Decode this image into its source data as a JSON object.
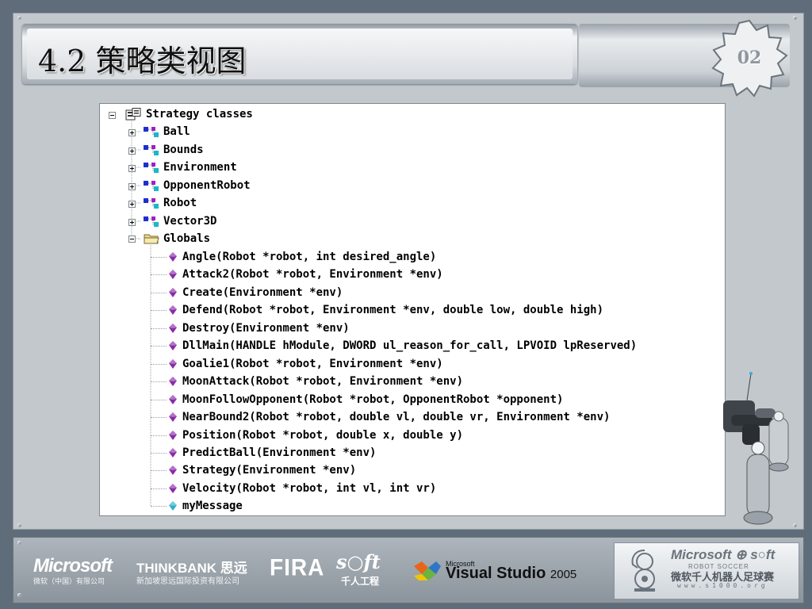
{
  "slide": {
    "title": "4.2 策略类视图",
    "page_number": "02"
  },
  "tree": {
    "root": {
      "label": "Strategy classes",
      "expanded": true
    },
    "classes": [
      {
        "label": "Ball",
        "expanded": false
      },
      {
        "label": "Bounds",
        "expanded": false
      },
      {
        "label": "Environment",
        "expanded": false
      },
      {
        "label": "OpponentRobot",
        "expanded": false
      },
      {
        "label": "Robot",
        "expanded": false
      },
      {
        "label": "Vector3D",
        "expanded": false
      }
    ],
    "globals": {
      "label": "Globals",
      "expanded": true,
      "items": [
        {
          "label": "Angle(Robot *robot, int desired_angle)",
          "kind": "function"
        },
        {
          "label": "Attack2(Robot *robot, Environment *env)",
          "kind": "function"
        },
        {
          "label": "Create(Environment *env)",
          "kind": "function"
        },
        {
          "label": "Defend(Robot *robot, Environment *env, double low, double high)",
          "kind": "function"
        },
        {
          "label": "Destroy(Environment *env)",
          "kind": "function"
        },
        {
          "label": "DllMain(HANDLE hModule, DWORD ul_reason_for_call, LPVOID lpReserved)",
          "kind": "function"
        },
        {
          "label": "Goalie1(Robot *robot, Environment *env)",
          "kind": "function"
        },
        {
          "label": "MoonAttack(Robot *robot, Environment *env)",
          "kind": "function"
        },
        {
          "label": "MoonFollowOpponent(Robot *robot, OpponentRobot *opponent)",
          "kind": "function"
        },
        {
          "label": "NearBound2(Robot *robot, double vl, double vr, Environment *env)",
          "kind": "function"
        },
        {
          "label": "Position(Robot *robot, double x, double y)",
          "kind": "function"
        },
        {
          "label": "PredictBall(Environment *env)",
          "kind": "function"
        },
        {
          "label": "Strategy(Environment *env)",
          "kind": "function"
        },
        {
          "label": "Velocity(Robot *robot, int vl, int vr)",
          "kind": "function"
        },
        {
          "label": "myMessage",
          "kind": "variable"
        }
      ]
    }
  },
  "footer": {
    "microsoft": "Microsoft",
    "microsoft_sub": "微软（中国）有限公司",
    "thinkbank": "THINKBANK 思远",
    "thinkbank_sub": "新加坡思远国际投资有限公司",
    "fira": "FIRA",
    "soft": "s○ft",
    "soft_sub": "千人工程",
    "vs_small": "Microsoft",
    "vs_main": "Visual Studio",
    "vs_year": "2005",
    "sponsor_ms": "Microsoft ⊕ s○ft",
    "sponsor_robot": "ROBOT SOCCER",
    "sponsor_cn": "微软千人机器人足球赛",
    "sponsor_url": "www.s1000.org"
  },
  "colors": {
    "class_icon_blue": "#1e2fd2",
    "class_icon_purple": "#a020c0",
    "class_icon_cyan": "#18b8c8",
    "function_icon": "#8a2aa8",
    "variable_icon": "#2ab0c8",
    "folder": "#e8d890"
  },
  "icons": {
    "class": "class-icon",
    "function": "function-icon",
    "variable": "variable-icon",
    "folder": "folder-icon",
    "root": "classview-icon"
  }
}
